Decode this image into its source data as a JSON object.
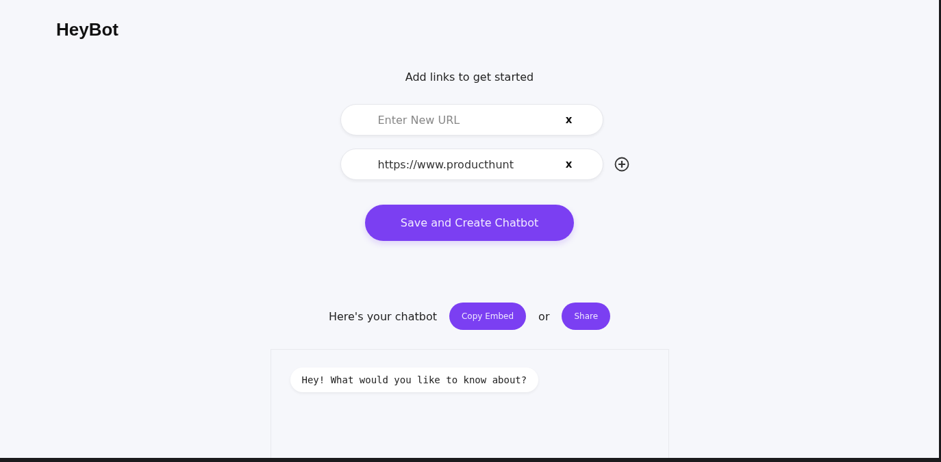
{
  "app": {
    "title": "HeyBot"
  },
  "heading": "Add links to get started",
  "url_fields": [
    {
      "placeholder": "Enter New URL",
      "clear_label": "x",
      "can_add": false
    },
    {
      "value": "https://www.producthunt",
      "clear_label": "x",
      "can_add": true
    }
  ],
  "save_button": "Save and Create Chatbot",
  "chatbot_bar": {
    "label": "Here's your chatbot",
    "copy_button": "Copy Embed",
    "separator": "or",
    "share_button": "Share"
  },
  "chat": {
    "messages": [
      "Hey! What would you like to know about?"
    ]
  }
}
